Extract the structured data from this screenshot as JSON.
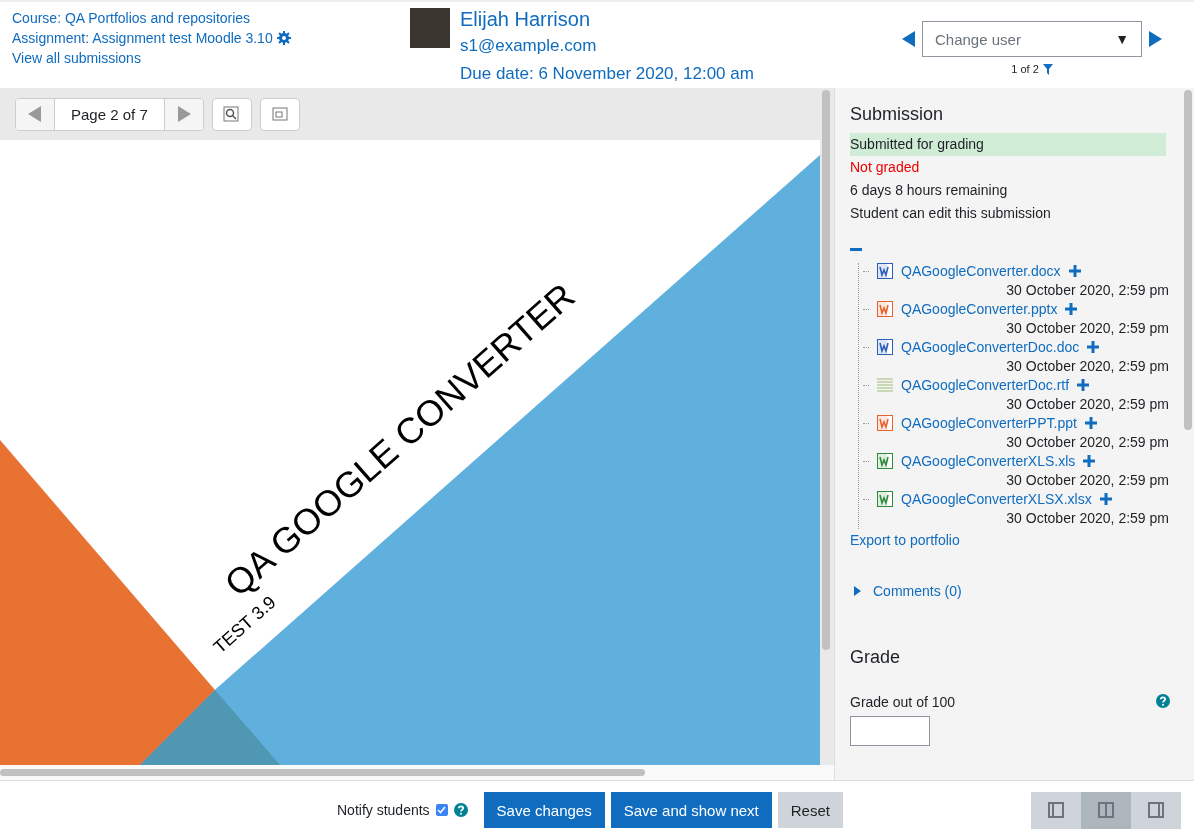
{
  "header": {
    "links": [
      "Course: QA Portfolios and repositories",
      "Assignment: Assignment test Moodle 3.10",
      "View all submissions"
    ],
    "user": {
      "name": "Elijah Harrison",
      "email": "s1@example.com",
      "due": "Due date: 6 November 2020, 12:00 am"
    },
    "change_user": {
      "placeholder": "Change user",
      "caret": "▼",
      "count": "1 of 2"
    }
  },
  "viewer": {
    "page_label": "Page 2 of 7",
    "slide": {
      "title": "QA GOOGLE CONVERTER",
      "subtitle": "TEST 3.9"
    }
  },
  "submission": {
    "heading": "Submission",
    "statuses": [
      {
        "text": "Submitted for grading",
        "kind": "success"
      },
      {
        "text": "Not graded",
        "kind": "danger"
      },
      {
        "text": "6 days 8 hours remaining",
        "kind": "plain"
      },
      {
        "text": "Student can edit this submission",
        "kind": "plain"
      }
    ],
    "files_expanded": true,
    "files": [
      {
        "name": "QAGoogleConverter.docx",
        "date": "30 October 2020, 2:59 pm",
        "kind": "word"
      },
      {
        "name": "QAGoogleConverter.pptx",
        "date": "30 October 2020, 2:59 pm",
        "kind": "powerpoint"
      },
      {
        "name": "QAGoogleConverterDoc.doc",
        "date": "30 October 2020, 2:59 pm",
        "kind": "word"
      },
      {
        "name": "QAGoogleConverterDoc.rtf",
        "date": "30 October 2020, 2:59 pm",
        "kind": "text"
      },
      {
        "name": "QAGoogleConverterPPT.ppt",
        "date": "30 October 2020, 2:59 pm",
        "kind": "powerpoint"
      },
      {
        "name": "QAGoogleConverterXLS.xls",
        "date": "30 October 2020, 2:59 pm",
        "kind": "excel"
      },
      {
        "name": "QAGoogleConverterXLSX.xlsx",
        "date": "30 October 2020, 2:59 pm",
        "kind": "excel"
      }
    ],
    "export_link": "Export to portfolio",
    "comments": {
      "label": "Comments (0)",
      "expanded": false
    }
  },
  "grade": {
    "heading": "Grade",
    "label": "Grade out of 100"
  },
  "footer": {
    "notify": {
      "label": "Notify students",
      "checked": true
    },
    "buttons": [
      {
        "label": "Save changes",
        "kind": "primary"
      },
      {
        "label": "Save and show next",
        "kind": "primary"
      },
      {
        "label": "Reset",
        "kind": "secondary"
      }
    ],
    "layouts": [
      {
        "selected": false,
        "kind": "left"
      },
      {
        "selected": true,
        "kind": "both"
      },
      {
        "selected": false,
        "kind": "right"
      }
    ]
  }
}
